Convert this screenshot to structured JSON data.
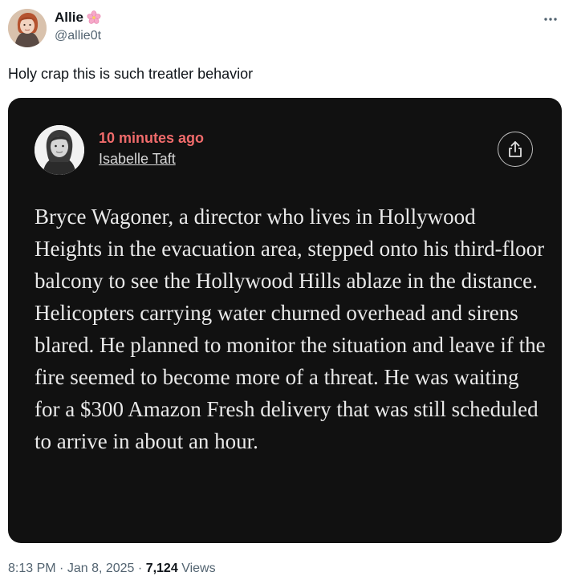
{
  "author": {
    "display_name": "Allie",
    "handle": "@allie0t",
    "emoji_icon": "cherry-blossom-icon"
  },
  "tweet": {
    "text": "Holy crap this is such treatler behavior"
  },
  "quoted_article": {
    "time_ago": "10 minutes ago",
    "author_name": "Isabelle Taft",
    "body": "Bryce Wagoner, a director who lives in Hollywood Heights in the evacuation area, stepped onto his third-floor balcony to see the Hollywood Hills ablaze in the distance. Helicopters carrying water churned overhead and sirens blared. He planned to monitor the situation and leave if the fire seemed to become more of a threat. He was waiting for a $300 Amazon Fresh delivery that was still scheduled to arrive in about an hour.",
    "time_color": "#f06b6b",
    "background_color": "#111111"
  },
  "footer": {
    "time": "8:13 PM",
    "separator": "·",
    "date": "Jan 8, 2025",
    "views_count": "7,124",
    "views_label": "Views"
  }
}
